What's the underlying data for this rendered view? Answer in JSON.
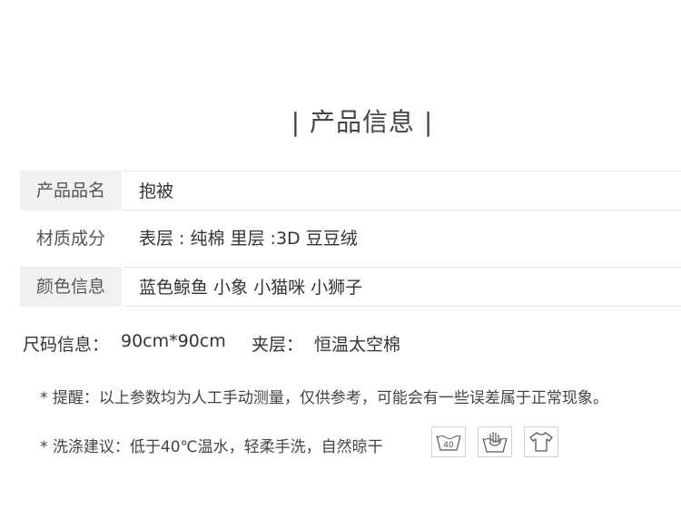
{
  "title": "| 产品信息 |",
  "spec_rows": [
    {
      "label": "产品品名",
      "value": "抱被"
    },
    {
      "label": "材质成分",
      "value": "表层 : 纯棉  里层 :3D 豆豆绒"
    },
    {
      "label": "颜色信息",
      "value": "蓝色鲸鱼  小象   小猫咪  小狮子"
    }
  ],
  "size_line": {
    "label": "尺码信息：",
    "size": "90cm*90cm",
    "layer_label": "夹层：",
    "layer_value": "恒温太空棉"
  },
  "reminder": "* 提醒：以上参数均为人工手动测量，仅供参考，可能会有一些误差属于正常现象。",
  "wash_advice": "* 洗涤建议：低于40℃温水，轻柔手洗，自然晾干",
  "wash_icons": [
    {
      "icon": "wash-40-icon",
      "text": "40"
    },
    {
      "icon": "hand-wash-icon"
    },
    {
      "icon": "tshirt-icon"
    }
  ]
}
